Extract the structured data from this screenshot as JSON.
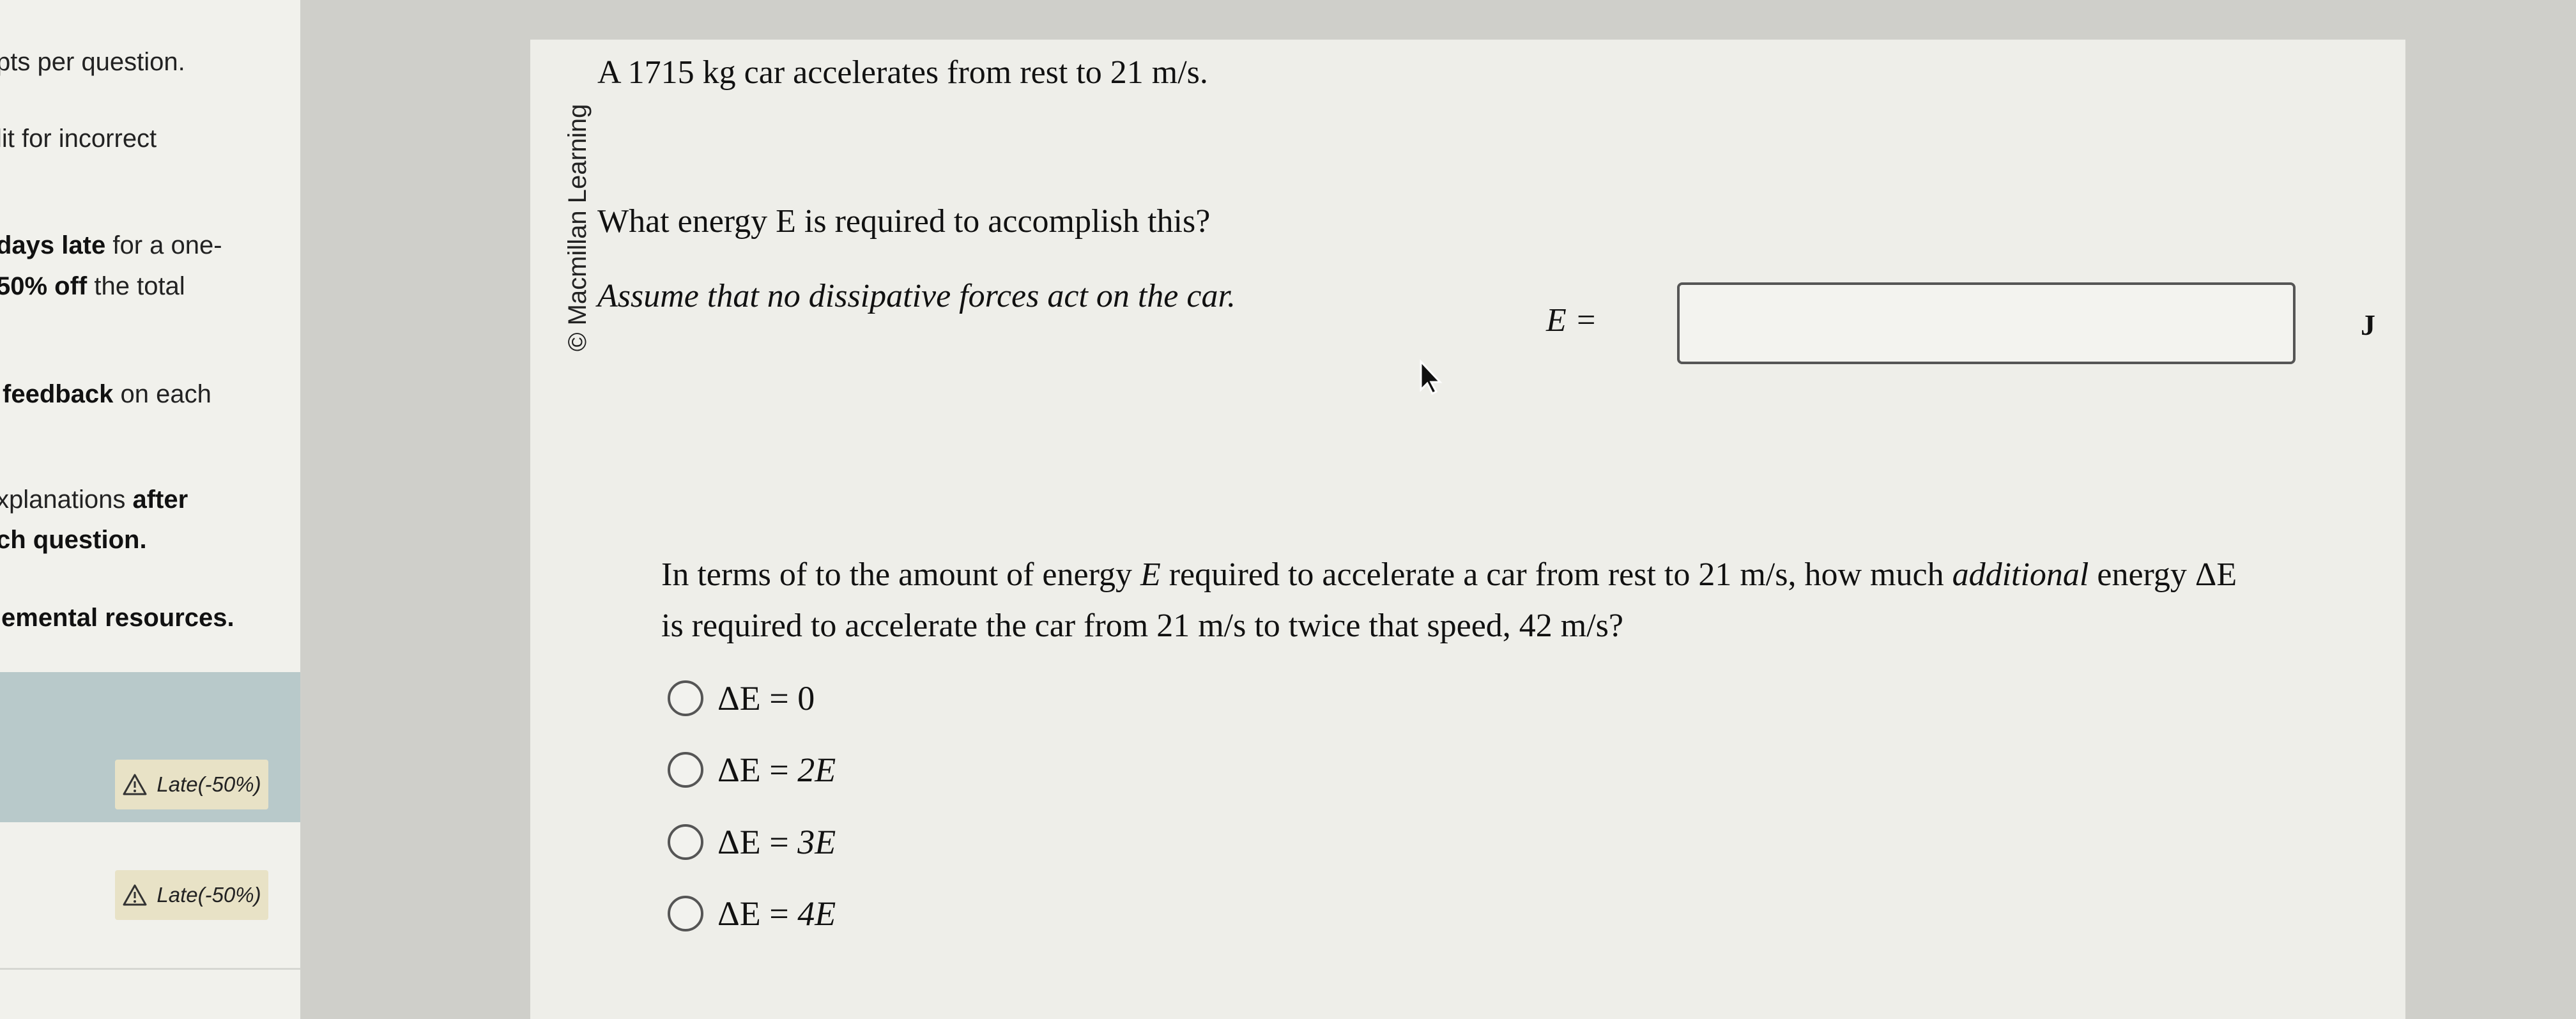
{
  "sidebar": {
    "fragments": [
      {
        "pre": "pts per question.",
        "bold": "",
        "post": ""
      },
      {
        "pre": "lit for incorrect",
        "bold": "",
        "post": ""
      },
      {
        "pre": "",
        "bold": "days late",
        "post": " for a one-"
      },
      {
        "pre": "",
        "bold": "50% off",
        "post": " the total"
      },
      {
        "pre": "",
        "bold": "feedback",
        "post": " on each"
      },
      {
        "pre": "xplanations ",
        "bold": "after",
        "post": ""
      },
      {
        "pre": "",
        "bold": "ch question.",
        "post": ""
      },
      {
        "pre": "",
        "bold": "emental resources.",
        "post": ""
      }
    ],
    "late_badges": [
      "Late(-50%)",
      "Late(-50%)"
    ]
  },
  "question": {
    "credit": "© Macmillan Learning",
    "statement": "A 1715 kg car accelerates from rest to 21 m/s.",
    "prompt": "What energy E is required to accomplish this?",
    "assumption": "Assume that no dissipative forces act on the car.",
    "answer_label": "E =",
    "answer_value": "",
    "answer_unit": "J"
  },
  "part2": {
    "line1": {
      "a": "In terms of to the amount of energy ",
      "b": "E",
      "c": " required to accelerate a car from rest to 21 m/s, how much ",
      "d": "additional",
      "e": " energy ΔE"
    },
    "line2": "is required to accelerate the car from 21 m/s to twice that speed, 42 m/s?",
    "options": [
      {
        "lhs": "ΔE",
        "rel": " = ",
        "rhs": "0"
      },
      {
        "lhs": "ΔE",
        "rel": " = ",
        "rhs": "2E"
      },
      {
        "lhs": "ΔE",
        "rel": " = ",
        "rhs": "3E"
      },
      {
        "lhs": "ΔE",
        "rel": " = ",
        "rhs": "4E"
      }
    ]
  },
  "colors": {
    "sidebar_active": "#b8c9ca",
    "late_badge_bg": "#e8e2c6",
    "panel_bg": "#eeeee9"
  },
  "icons": [
    "warning-triangle-icon",
    "radio-circle-icon",
    "mouse-pointer-icon"
  ]
}
